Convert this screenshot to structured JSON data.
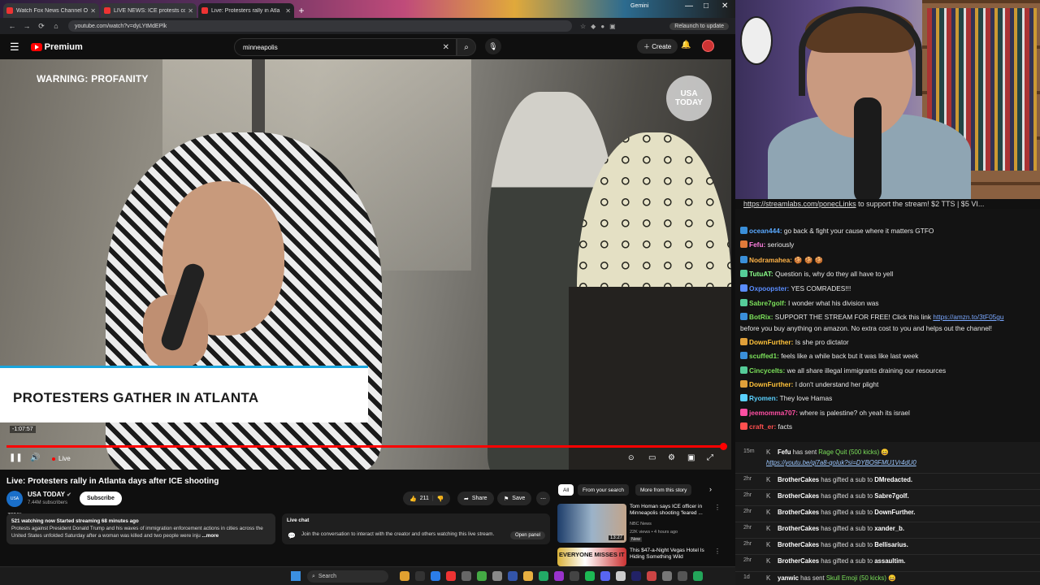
{
  "browser": {
    "tabs": [
      {
        "title": "Watch Fox News Channel O",
        "active": false
      },
      {
        "title": "LIVE NEWS: ICE protests contin",
        "active": false
      },
      {
        "title": "Live: Protesters rally in Atla",
        "active": true
      }
    ],
    "new_tab": "+",
    "gemini_label": "Gemini",
    "url": "youtube.com/watch?v=dyLYtMdEPlk",
    "relaunch_label": "Relaunch to update"
  },
  "youtube": {
    "logo_text": "Premium",
    "search_value": "minneapolis",
    "create_label": "Create"
  },
  "video": {
    "warning": "WARNING: PROFANITY",
    "watermark": "USA TODAY",
    "lower_third": "PROTESTERS GATHER IN ATLANTA",
    "time_tooltip": "-1:07:57",
    "live_label": "Live",
    "progress": 1.0
  },
  "meta": {
    "title": "Live: Protesters rally in Atlanta days after ICE shooting",
    "channel": "USA TODAY",
    "channel_avatar_text": "USA TODAY",
    "subscribers": "7.44M subscribers",
    "subscribe_label": "Subscribe",
    "likes": "211",
    "share_label": "Share",
    "save_label": "Save",
    "desc_stats": "521 watching now  Started streaming 68 minutes ago",
    "desc_text": "Protests against President Donald Trump and his waves of immigration enforcement actions in cities across the United States unfolded Saturday after a woman was killed and two people were inju",
    "desc_more": "...more",
    "livechat_label": "Live chat",
    "livechat_msg": "Join the conversation to interact with the creator and others watching this live stream.",
    "open_panel": "Open panel"
  },
  "filters": [
    "All",
    "From your search",
    "More from this story"
  ],
  "recommendations": [
    {
      "title": "Tom Homan says ICE officer in Minneapolis shooting 'feared ...",
      "channel": "NBC News",
      "stats": "22K views • 4 hours ago",
      "badge": "New",
      "duration": "13:27"
    },
    {
      "title": "This $47-a-Night Vegas Hotel Is Hiding Something Wild",
      "thumb_text": "EVERYONE MISSES IT"
    }
  ],
  "taskbar": {
    "search_label": "Search"
  },
  "stream": {
    "banner_link": "https://streamlabs.com/ponecLinks",
    "banner_text": " to support the stream! $2 TTS | $5 VI...",
    "chat": [
      {
        "user": "ocean444:",
        "color": "#5aa9ff",
        "text": " go back & fight your cause where it matters GTFO"
      },
      {
        "user": "Fefu:",
        "color": "#ff7ee0",
        "text": " seriously"
      },
      {
        "user": "Nodramahea:",
        "color": "#ffb347",
        "text": " 🍪 🍪 🍪"
      },
      {
        "user": "TutuAT:",
        "color": "#8aff8a",
        "text": " Question is, why do they all have to yell"
      },
      {
        "user": "Oxpoopster:",
        "color": "#5a8dff",
        "text": " YES COMRADES!!!"
      },
      {
        "user": "Sabre7golf:",
        "color": "#7be05a",
        "text": " I wonder what his division was"
      },
      {
        "user": "BotRix:",
        "color": "#7be05a",
        "text": " SUPPORT THE STREAM FOR FREE! Click this link ",
        "link": "https://amzn.to/3tF05gu"
      },
      {
        "user": "",
        "color": "#e8e8e8",
        "text": "before you buy anything on amazon. No extra cost to you and helps out the channel!"
      },
      {
        "user": "DownFurther:",
        "color": "#ffc23a",
        "text": " Is she pro dictator"
      },
      {
        "user": "scuffed1:",
        "color": "#7be05a",
        "text": " feels like a while back but it was like last week"
      },
      {
        "user": "Cincycelts:",
        "color": "#7be05a",
        "text": " we all share illegal immigrants draining our resources"
      },
      {
        "user": "DownFurther:",
        "color": "#ffc23a",
        "text": " I don't understand her plight"
      },
      {
        "user": "Ryomen:",
        "color": "#5ad1ff",
        "text": " They love Hamas"
      },
      {
        "user": "jeemomma707:",
        "color": "#ff4fa3",
        "text": " where is palestine? oh yeah its israel"
      },
      {
        "user": "craft_er:",
        "color": "#ff4f4f",
        "text": " facts"
      }
    ],
    "feed": [
      {
        "time": "15m",
        "user": "Fefu",
        "mid": " has sent ",
        "item": "Rage Quit (500 kicks)",
        "link": "https://youtu.be/qi7a8-qoIuk?si=DYBO9FMU1Vr4dU0"
      },
      {
        "time": "2hr",
        "user": "BrotherCakes",
        "mid": " has gifted a sub to ",
        "target": "DMredacted."
      },
      {
        "time": "2hr",
        "user": "BrotherCakes",
        "mid": " has gifted a sub to ",
        "target": "Sabre7golf."
      },
      {
        "time": "2hr",
        "user": "BrotherCakes",
        "mid": " has gifted a sub to ",
        "target": "DownFurther."
      },
      {
        "time": "2hr",
        "user": "BrotherCakes",
        "mid": " has gifted a sub to ",
        "target": "xander_b."
      },
      {
        "time": "2hr",
        "user": "BrotherCakes",
        "mid": " has gifted a sub to ",
        "target": "Bellisarius."
      },
      {
        "time": "2hr",
        "user": "BrotherCakes",
        "mid": " has gifted a sub to ",
        "target": "assaultim."
      },
      {
        "time": "1d",
        "user": "yanwic",
        "mid": " has sent ",
        "item": "Skull Emoji (50 kicks)"
      }
    ]
  }
}
